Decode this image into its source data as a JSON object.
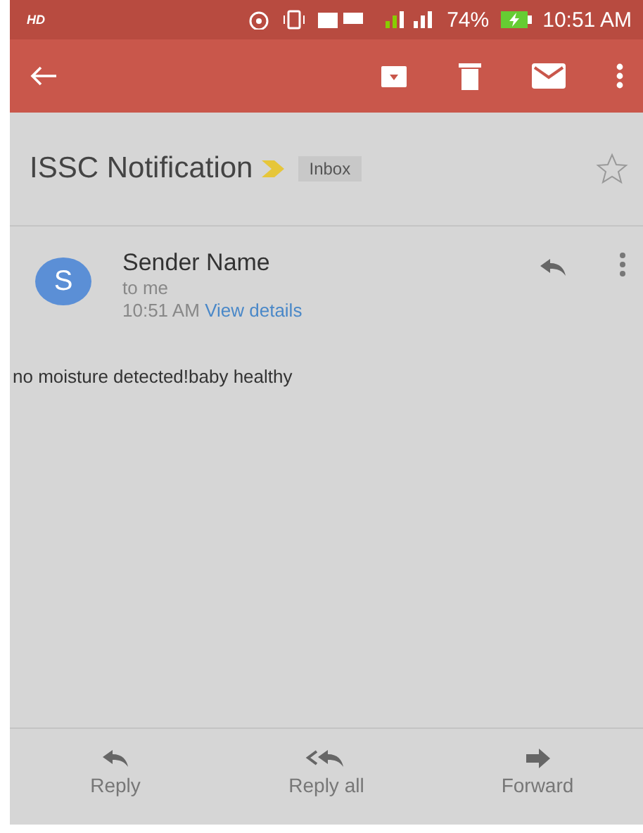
{
  "status_bar": {
    "label": "HD",
    "battery": "74%",
    "time": "10:51 AM"
  },
  "toolbar": {
    "actions": [
      {
        "kind": "archive"
      },
      {
        "kind": "delete"
      },
      {
        "kind": "mail"
      },
      {
        "kind": "more"
      }
    ]
  },
  "subject": {
    "title": "ISSC Notification",
    "important": true,
    "label": "Inbox",
    "starred": false
  },
  "message": {
    "avatar": "S",
    "sender": "Sender Name",
    "recipient": "to me",
    "time": "10:51 AM",
    "details_link": "View details",
    "body": "no moisture detected!baby healthy"
  },
  "bottom_actions": [
    {
      "kind": "reply",
      "label": "Reply"
    },
    {
      "kind": "reply_all",
      "label": "Reply all"
    },
    {
      "kind": "forward",
      "label": "Forward"
    }
  ]
}
